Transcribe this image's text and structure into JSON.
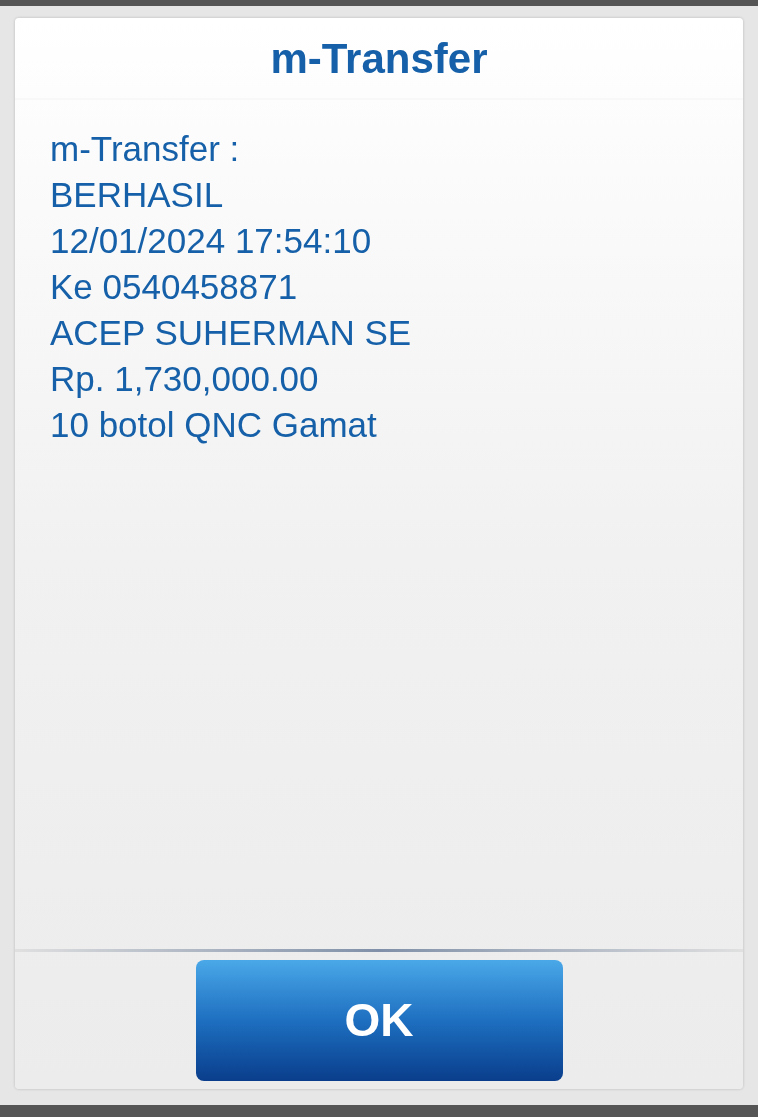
{
  "dialog": {
    "title": "m-Transfer",
    "lines": [
      "m-Transfer :",
      "BERHASIL",
      "12/01/2024 17:54:10",
      "Ke 0540458871",
      "ACEP SUHERMAN SE",
      "Rp. 1,730,000.00",
      "10 botol QNC Gamat"
    ],
    "buttons": [
      "OK"
    ]
  }
}
